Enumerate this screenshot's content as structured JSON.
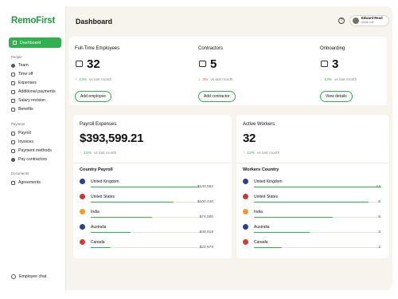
{
  "app": {
    "logo": "RemoFirst"
  },
  "header": {
    "title": "Dashboard",
    "help_icon": "question-circle-icon",
    "user": {
      "name": "Edward Read",
      "role": "Admin role"
    }
  },
  "sidebar": {
    "active": {
      "label": "Dashboard",
      "icon": "grid-icon"
    },
    "sections": [
      {
        "label": "People",
        "items": [
          {
            "label": "Team",
            "icon": "people-icon"
          },
          {
            "label": "Time off",
            "icon": "calendar-icon"
          },
          {
            "label": "Expenses",
            "icon": "receipt-icon"
          },
          {
            "label": "Additional payments",
            "icon": "cash-icon"
          },
          {
            "label": "Salary revision",
            "icon": "money-icon"
          },
          {
            "label": "Benefits",
            "icon": "shield-icon"
          }
        ]
      },
      {
        "label": "Payment",
        "items": [
          {
            "label": "Payroll",
            "icon": "payroll-icon"
          },
          {
            "label": "Invoices",
            "icon": "invoice-icon"
          },
          {
            "label": "Payment methods",
            "icon": "card-icon"
          },
          {
            "label": "Pay contractors",
            "icon": "send-icon"
          }
        ]
      },
      {
        "label": "Documents",
        "items": [
          {
            "label": "Agreements",
            "icon": "document-icon"
          }
        ]
      }
    ],
    "footer": {
      "label": "Employee chat",
      "icon": "chat-icon"
    }
  },
  "kpis": [
    {
      "title": "Full-Time Employees",
      "value": "32",
      "trend_arrow": "↑",
      "trend_pct": "13%",
      "trend_text": "vs last month",
      "trend_dir": "up",
      "button": "Add employee",
      "icon": "employees-icon"
    },
    {
      "title": "Contractors",
      "value": "5",
      "trend_arrow": "↓",
      "trend_pct": "3%",
      "trend_text": "vs last month",
      "trend_dir": "down",
      "button": "Add contractor",
      "icon": "contractors-icon"
    },
    {
      "title": "Onboarding",
      "value": "3",
      "trend_arrow": "↑",
      "trend_pct": "13%",
      "trend_text": "vs last month",
      "trend_dir": "up",
      "button": "View details",
      "icon": "onboarding-icon"
    }
  ],
  "payroll": {
    "title": "Payroll Expenses",
    "value": "$393,599.21",
    "trend_arrow": "↑",
    "trend_pct": "15%",
    "trend_text": "vs last month",
    "list_title": "Country Payroll",
    "rows": [
      {
        "country": "United Kingdom",
        "amount": "$140,562",
        "fill": 0.97,
        "flag": "uk-flag-icon",
        "flag_color": "#2b3f8c"
      },
      {
        "country": "United States",
        "amount": "$100,440",
        "fill": 0.74,
        "flag": "us-flag-icon",
        "flag_color": "#c23a3a"
      },
      {
        "country": "India",
        "amount": "$74,000",
        "fill": 0.55,
        "flag": "india-flag-icon",
        "flag_color": "#f39a2c"
      },
      {
        "country": "Australia",
        "amount": "$45,918",
        "fill": 0.36,
        "flag": "australia-flag-icon",
        "flag_color": "#2b3f8c"
      },
      {
        "country": "Canada",
        "amount": "$22,679",
        "fill": 0.18,
        "flag": "canada-flag-icon",
        "flag_color": "#d83a3a"
      }
    ]
  },
  "workers": {
    "title": "Active Workers",
    "value": "32",
    "trend_arrow": "↑",
    "trend_pct": "12%",
    "trend_text": "vs last month",
    "list_title": "Workers Country",
    "rows": [
      {
        "country": "United Kingdom",
        "amount": "12",
        "fill": 1.0,
        "flag": "uk-flag-icon",
        "flag_color": "#2b3f8c"
      },
      {
        "country": "United States",
        "amount": "8",
        "fill": 0.9,
        "flag": "us-flag-icon",
        "flag_color": "#c23a3a"
      },
      {
        "country": "India",
        "amount": "6",
        "fill": 0.62,
        "flag": "india-flag-icon",
        "flag_color": "#f39a2c"
      },
      {
        "country": "Australia",
        "amount": "4",
        "fill": 0.44,
        "flag": "australia-flag-icon",
        "flag_color": "#2b3f8c"
      },
      {
        "country": "Canada",
        "amount": "2",
        "fill": 0.22,
        "flag": "canada-flag-icon",
        "flag_color": "#d83a3a"
      }
    ]
  },
  "colors": {
    "accent": "#2fb14d",
    "down": "#e0562f",
    "background": "#f6f4ec"
  }
}
